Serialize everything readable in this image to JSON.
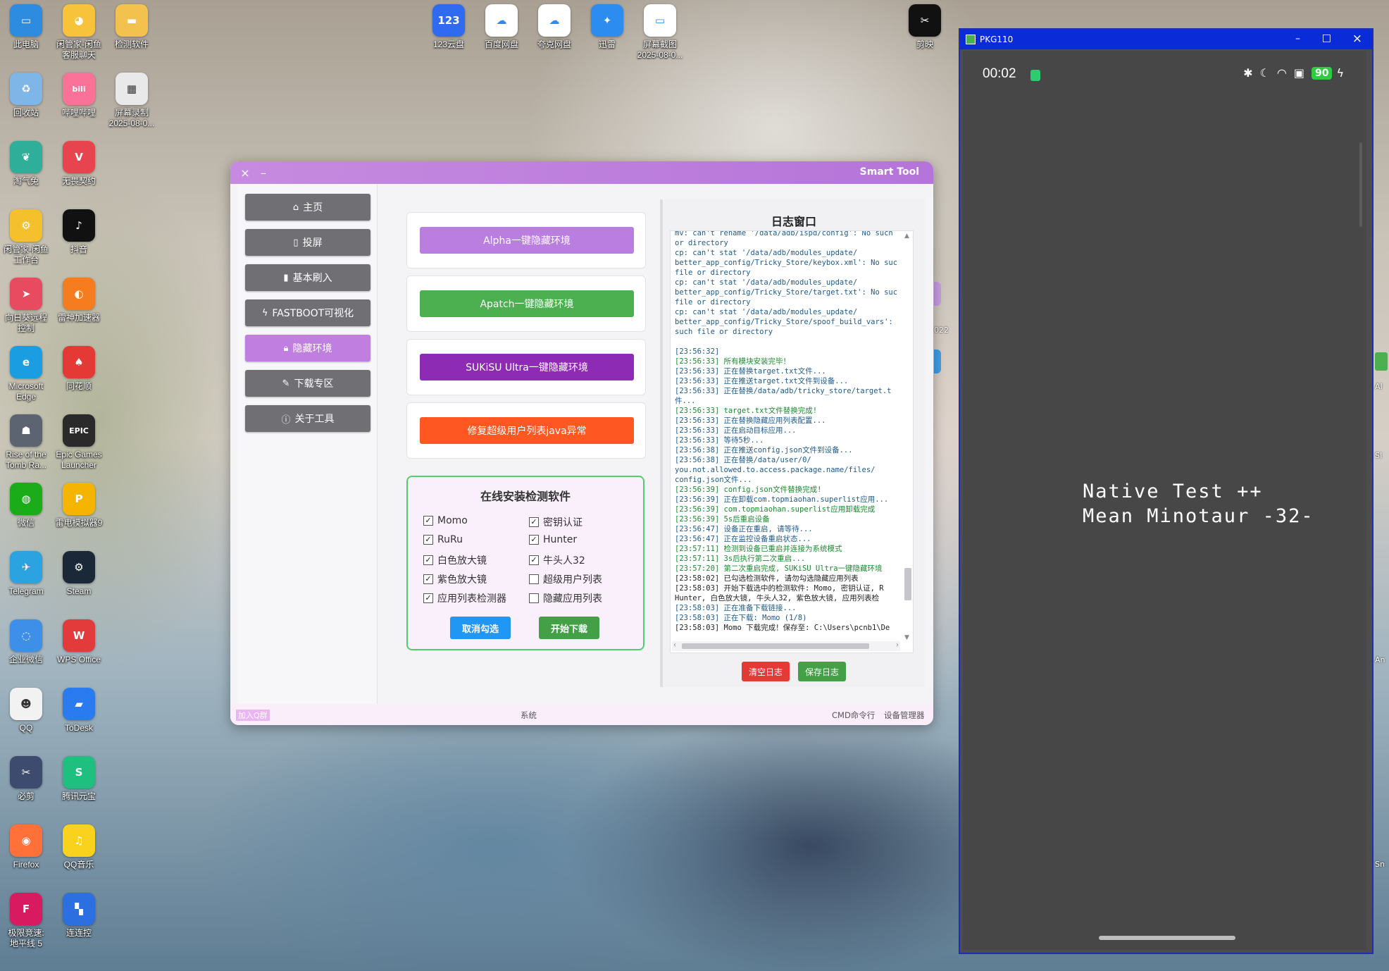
{
  "desktop_icons": [
    {
      "label": "此电脑",
      "color": "#2d8be0",
      "glyph": "▭",
      "icon": "computer-icon"
    },
    {
      "label": "闲管家-闲鱼\n客服聊天",
      "color": "#f7c33a",
      "glyph": "◕",
      "icon": "idle-fish-icon"
    },
    {
      "label": "检测软件",
      "color": "#f2c14e",
      "glyph": "▬",
      "icon": "folder-icon"
    },
    {
      "label": "回收站",
      "color": "#7fb6e8",
      "glyph": "♻",
      "icon": "recycle-bin-icon"
    },
    {
      "label": "哔哩哔哩",
      "color": "#fb7299",
      "glyph": "bili",
      "icon": "bilibili-icon"
    },
    {
      "label": "屏幕录制\n2025-08-0...",
      "color": "#e9e9e9",
      "glyph": "▦",
      "icon": "screen-record-file-icon"
    },
    {
      "label": "淘气兔",
      "color": "#2fae9a",
      "glyph": "❦",
      "icon": "rabbit-app-icon"
    },
    {
      "label": "无畏契约",
      "color": "#e8444f",
      "glyph": "V",
      "icon": "valorant-icon"
    },
    {
      "label": "闲管家-闲鱼\n工作台",
      "color": "#f4c02c",
      "glyph": "⚙",
      "icon": "idle-fish-workbench-icon"
    },
    {
      "label": "抖音",
      "color": "#111111",
      "glyph": "♪",
      "icon": "douyin-icon"
    },
    {
      "label": "向日葵远程\n控制",
      "color": "#e84a5f",
      "glyph": "➤",
      "icon": "sunflower-remote-icon"
    },
    {
      "label": "雷神加速器",
      "color": "#f57c1f",
      "glyph": "◐",
      "icon": "leishen-icon"
    },
    {
      "label": "Microsoft\nEdge",
      "color": "#1b9de2",
      "glyph": "e",
      "icon": "edge-icon"
    },
    {
      "label": "同花顺",
      "color": "#e53935",
      "glyph": "♠",
      "icon": "tonghuashun-icon"
    },
    {
      "label": "Rise of the\nTomb Ra...",
      "color": "#5b6470",
      "glyph": "☗",
      "icon": "tomb-raider-icon"
    },
    {
      "label": "Epic Games\nLauncher",
      "color": "#2a2a2a",
      "glyph": "EPIC",
      "icon": "epic-games-icon"
    },
    {
      "label": "微信",
      "color": "#1aad19",
      "glyph": "◍",
      "icon": "wechat-icon"
    },
    {
      "label": "雷电模拟器9",
      "color": "#f5b400",
      "glyph": "P",
      "icon": "ldplayer-icon"
    },
    {
      "label": "Telegram",
      "color": "#2aa3e0",
      "glyph": "✈",
      "icon": "telegram-icon"
    },
    {
      "label": "Steam",
      "color": "#1b2838",
      "glyph": "⚙",
      "icon": "steam-icon"
    },
    {
      "label": "企业微信",
      "color": "#3d8fe8",
      "glyph": "◌",
      "icon": "wecom-icon"
    },
    {
      "label": "WPS Office",
      "color": "#e33b3b",
      "glyph": "W",
      "icon": "wps-icon"
    },
    {
      "label": "QQ",
      "color": "#f2f2f2",
      "glyph": "☻",
      "icon": "qq-icon"
    },
    {
      "label": "ToDesk",
      "color": "#2b7bf0",
      "glyph": "▰",
      "icon": "todesk-icon"
    },
    {
      "label": "必剪",
      "color": "#3c4b6e",
      "glyph": "✂",
      "icon": "bijian-icon"
    },
    {
      "label": "腾讯元宝",
      "color": "#1fbf80",
      "glyph": "S",
      "icon": "yuanbao-icon"
    },
    {
      "label": "Firefox",
      "color": "#ff7139",
      "glyph": "◉",
      "icon": "firefox-icon"
    },
    {
      "label": "QQ音乐",
      "color": "#f8d21c",
      "glyph": "♫",
      "icon": "qq-music-icon"
    },
    {
      "label": "极限竞速:\n地平线 5",
      "color": "#d81b60",
      "glyph": "F",
      "icon": "forza-icon"
    },
    {
      "label": "连连控",
      "color": "#2c6fe0",
      "glyph": "▚",
      "icon": "lianliankong-icon"
    }
  ],
  "top_icons": [
    {
      "label": "123云盘",
      "color": "#2f6bf0",
      "glyph": "123",
      "icon": "123pan-icon"
    },
    {
      "label": "百度网盘",
      "color": "#ffffff",
      "glyph": "☁",
      "icon": "baidu-netdisk-icon"
    },
    {
      "label": "夸克网盘",
      "color": "#ffffff",
      "glyph": "☁",
      "icon": "quark-netdisk-icon"
    },
    {
      "label": "迅雷",
      "color": "#2d8cf0",
      "glyph": "✦",
      "icon": "xunlei-icon"
    },
    {
      "label": "屏幕截图\n2025-08-0...",
      "color": "#ffffff",
      "glyph": "▭",
      "icon": "screenshot-file-icon"
    },
    {
      "label": "剪映",
      "color": "#111111",
      "glyph": "✂",
      "icon": "capcut-icon"
    }
  ],
  "smart_tool": {
    "title": "Smart Tool",
    "close_glyph": "×",
    "min_glyph": "–",
    "sidebar": [
      {
        "label": "主页",
        "glyph": "⌂",
        "icon": "home-icon"
      },
      {
        "label": "投屏",
        "glyph": "▯",
        "icon": "cast-icon"
      },
      {
        "label": "基本刷入",
        "glyph": "▮",
        "icon": "flash-icon"
      },
      {
        "label": "FASTBOOT可视化",
        "glyph": "ϟ",
        "icon": "lightning-icon"
      },
      {
        "label": "隐藏环境",
        "glyph": "🔒︎",
        "icon": "lock-icon"
      },
      {
        "label": "下载专区",
        "glyph": "✎",
        "icon": "download-icon"
      },
      {
        "label": "关于工具",
        "glyph": "ⓘ",
        "icon": "info-icon"
      }
    ],
    "actions": [
      {
        "label": "Alpha一键隐藏环境",
        "color": "#b97ee0"
      },
      {
        "label": "Apatch一键隐藏环境",
        "color": "#4cb050"
      },
      {
        "label": "SUKiSU Ultra一键隐藏环境",
        "color": "#8e2bb5"
      },
      {
        "label": "修复超级用户列表java异常",
        "color": "#ff5722"
      }
    ],
    "detect": {
      "title": "在线安装检测软件",
      "items": [
        {
          "label": "Momo",
          "checked": true
        },
        {
          "label": "密钥认证",
          "checked": true
        },
        {
          "label": "RuRu",
          "checked": true
        },
        {
          "label": "Hunter",
          "checked": true
        },
        {
          "label": "白色放大镜",
          "checked": true
        },
        {
          "label": "牛头人32",
          "checked": true
        },
        {
          "label": "紫色放大镜",
          "checked": true
        },
        {
          "label": "超级用户列表",
          "checked": false
        },
        {
          "label": "应用列表检测器",
          "checked": true
        },
        {
          "label": "隐藏应用列表",
          "checked": false
        }
      ],
      "cancel_label": "取消勾选",
      "download_label": "开始下载"
    },
    "log": {
      "title": "日志窗口",
      "lines": [
        "mv: can't rename '/data/adb/ispd/config': No such",
        "or directory",
        "cp: can't stat '/data/adb/modules_update/",
        "better_app_config/Tricky_Store/keybox.xml': No suc",
        "file or directory",
        "cp: can't stat '/data/adb/modules_update/",
        "better_app_config/Tricky_Store/target.txt': No suc",
        "file or directory",
        "cp: can't stat '/data/adb/modules_update/",
        "better_app_config/Tricky_Store/spoof_build_vars':",
        "such file or directory",
        "",
        "[23:56:32]",
        "[23:56:33] 所有模块安装完毕！",
        "[23:56:33] 正在替换target.txt文件...",
        "[23:56:33] 正在推送target.txt文件到设备...",
        "[23:56:33] 正在替换/data/adb/tricky_store/target.t",
        "件...",
        "[23:56:33] target.txt文件替换完成!",
        "[23:56:33] 正在替换隐藏应用列表配置...",
        "[23:56:33] 正在启动目标应用...",
        "[23:56:33] 等待5秒...",
        "[23:56:38] 正在推送config.json文件到设备...",
        "[23:56:38] 正在替换/data/user/0/",
        "you.not.allowed.to.access.package.name/files/",
        "config.json文件...",
        "[23:56:39] config.json文件替换完成!",
        "[23:56:39] 正在卸载com.topmiaohan.superlist应用...",
        "[23:56:39] com.topmiaohan.superlist应用卸载完成",
        "[23:56:39] 5s后重启设备",
        "[23:56:47] 设备正在重启, 请等待...",
        "[23:56:47] 正在监控设备重启状态...",
        "[23:57:11] 检测到设备已重启并连接为系统模式",
        "[23:57:11] 3s后执行第二次重启...",
        "[23:57:20] 第二次重启完成, SUKiSU Ultra一键隐藏环境",
        "[23:58:02] 已勾选检测软件, 请勿勾选隐藏应用列表",
        "[23:58:03] 开始下载选中的检测软件: Momo, 密钥认证, R",
        "Hunter, 白色放大镜, 牛头人32, 紫色放大镜, 应用列表检",
        "[23:58:03] 正在准备下载链接...",
        "[23:58:03] 正在下载: Momo (1/8)",
        "[23:58:03] Momo 下载完成！保存至: C:\\Users\\pcnb1\\De"
      ],
      "clear_label": "清空日志",
      "save_label": "保存日志"
    },
    "status": {
      "left": "加入Q群",
      "center": "系统",
      "cmd": "CMD命令行",
      "devmgr": "设备管理器"
    }
  },
  "pkg_window": {
    "title": "PKG110",
    "min_glyph": "–",
    "max_glyph": "□",
    "close_glyph": "×",
    "time": "00:02",
    "battery": "90",
    "screen_text_1": "Native Test ++",
    "screen_text_2": "Mean Minotaur -32-"
  },
  "right_edge_labels": [
    "AI",
    "SI",
    "Sn",
    "An"
  ],
  "behind_label": "022"
}
